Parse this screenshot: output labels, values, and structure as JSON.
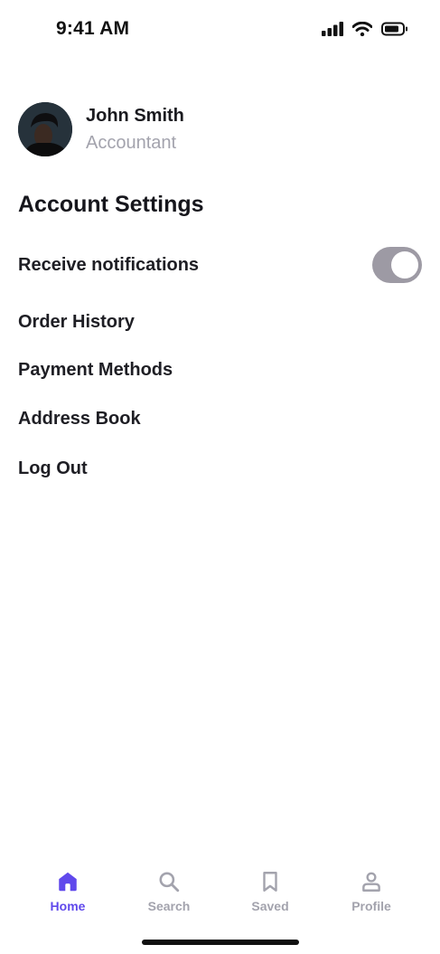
{
  "status_bar": {
    "time": "9:41 AM",
    "icons": [
      "signal-icon",
      "wifi-icon",
      "battery-icon"
    ]
  },
  "profile": {
    "name": "John Smith",
    "role": "Accountant"
  },
  "settings": {
    "title": "Account Settings",
    "notifications_label": "Receive notifications",
    "notifications_on": true,
    "items": [
      {
        "label": "Order History"
      },
      {
        "label": "Payment Methods"
      },
      {
        "label": "Address Book"
      },
      {
        "label": "Log Out"
      }
    ]
  },
  "tab_bar": {
    "tabs": [
      {
        "label": "Home",
        "icon": "home-icon",
        "active": true
      },
      {
        "label": "Search",
        "icon": "search-icon",
        "active": false
      },
      {
        "label": "Saved",
        "icon": "bookmark-icon",
        "active": false
      },
      {
        "label": "Profile",
        "icon": "profile-icon",
        "active": false
      }
    ]
  },
  "colors": {
    "accent": "#6049ec",
    "inactive": "#a3a3ad",
    "toggle_track": "#9d9aa4"
  }
}
